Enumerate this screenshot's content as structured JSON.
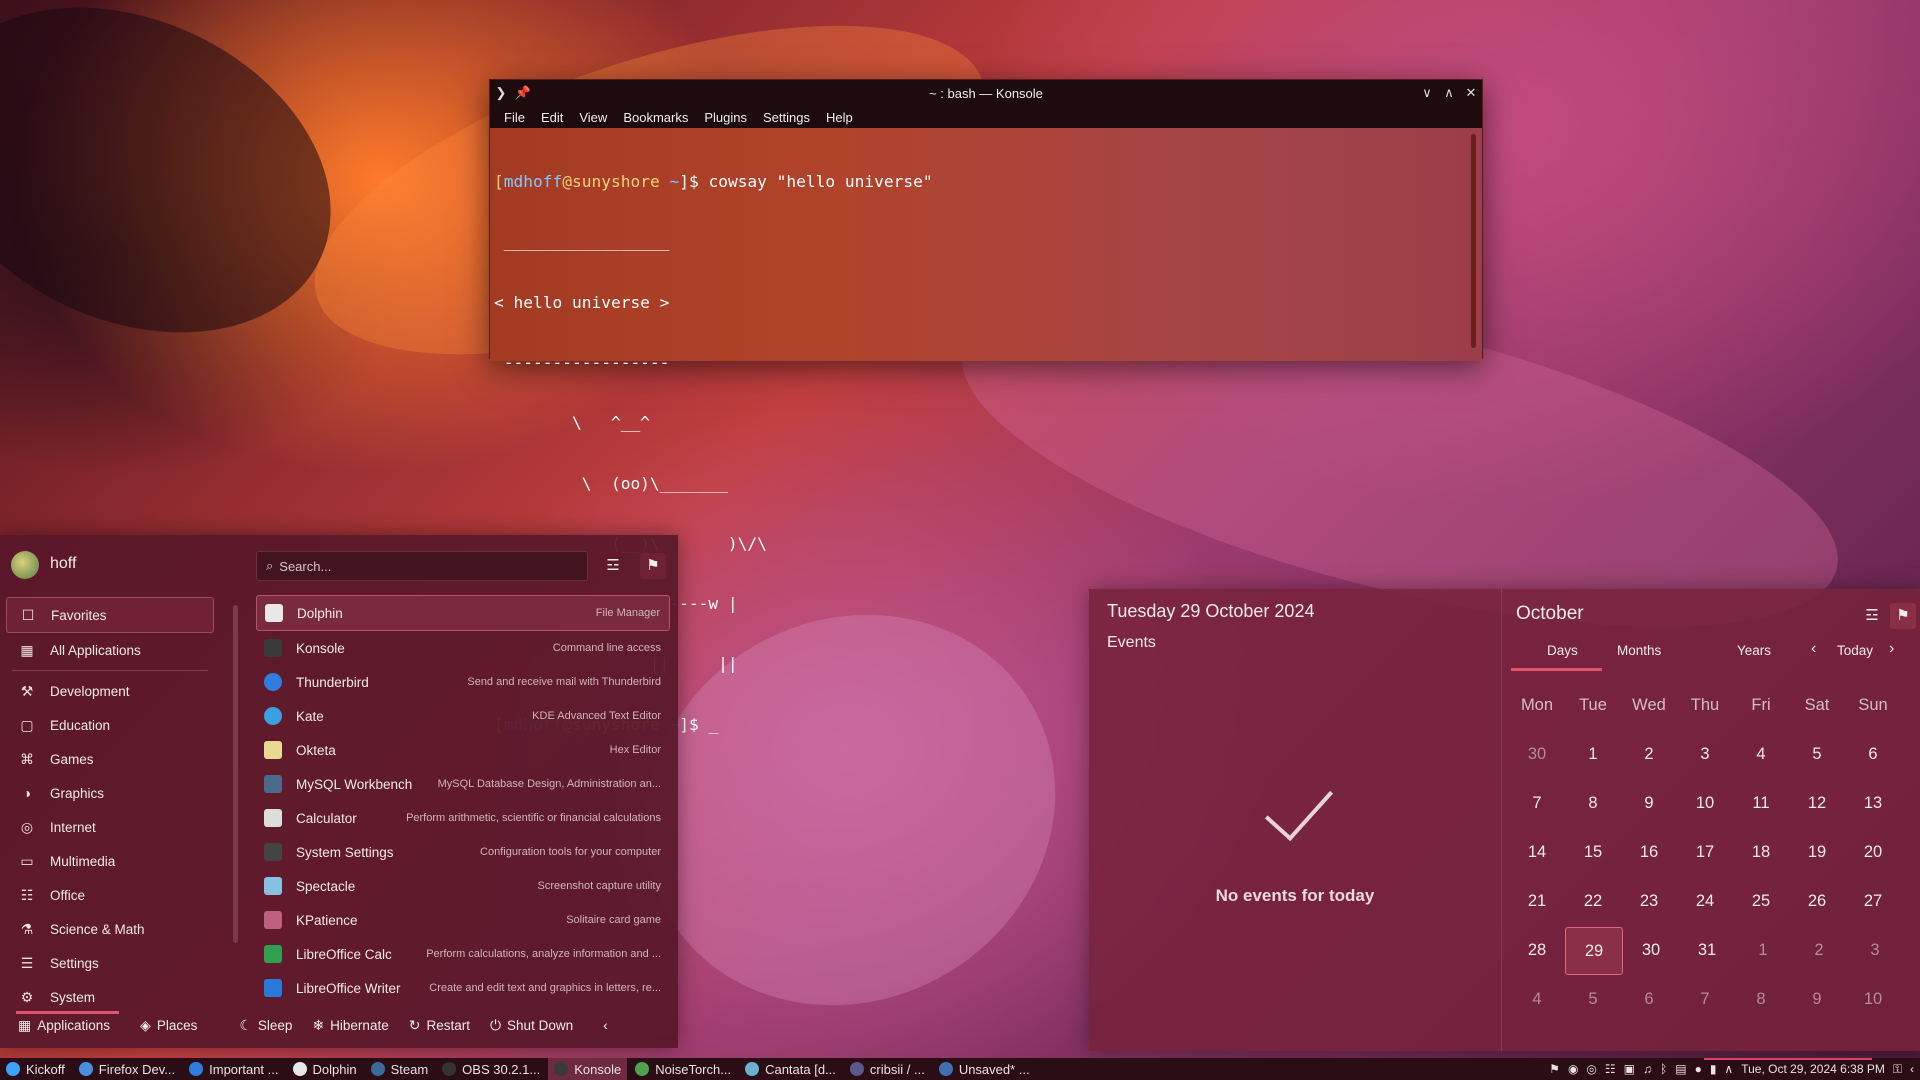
{
  "konsole": {
    "title": "~ : bash — Konsole",
    "menu": [
      "File",
      "Edit",
      "View",
      "Bookmarks",
      "Plugins",
      "Settings",
      "Help"
    ],
    "user": "mdhoff",
    "at": "@",
    "host": "sunyshore",
    "path": " ~",
    "prompt_end": "]$ ",
    "command": "cowsay \"hello universe\"",
    "output": [
      " _________________",
      "< hello universe >",
      " -----------------",
      "        \\   ^__^",
      "         \\  (oo)\\_______",
      "            (__)\\       )\\/\\",
      "                ||----w |",
      "                ||     ||"
    ],
    "cursor": "_"
  },
  "kickoff": {
    "username": "hoff",
    "search_placeholder": "Search...",
    "categories": [
      "Favorites",
      "All Applications",
      "Development",
      "Education",
      "Games",
      "Graphics",
      "Internet",
      "Multimedia",
      "Office",
      "Science & Math",
      "Settings",
      "System"
    ],
    "apps": [
      {
        "name": "Dolphin",
        "desc": "File Manager",
        "color": "#e8e8e8"
      },
      {
        "name": "Konsole",
        "desc": "Command line access",
        "color": "#3a3a3a"
      },
      {
        "name": "Thunderbird",
        "desc": "Send and receive mail with Thunderbird",
        "color": "#2f7de1"
      },
      {
        "name": "Kate",
        "desc": "KDE Advanced Text Editor",
        "color": "#3aa0e0"
      },
      {
        "name": "Okteta",
        "desc": "Hex Editor",
        "color": "#e8d890"
      },
      {
        "name": "MySQL Workbench",
        "desc": "MySQL Database Design, Administration an...",
        "color": "#4a6a8a"
      },
      {
        "name": "Calculator",
        "desc": "Perform arithmetic, scientific or financial calculations",
        "color": "#dddddd"
      },
      {
        "name": "System Settings",
        "desc": "Configuration tools for your computer",
        "color": "#444444"
      },
      {
        "name": "Spectacle",
        "desc": "Screenshot capture utility",
        "color": "#88c0e0"
      },
      {
        "name": "KPatience",
        "desc": "Solitaire card game",
        "color": "#c06080"
      },
      {
        "name": "LibreOffice Calc",
        "desc": "Perform calculations, analyze information and ...",
        "color": "#30a050"
      },
      {
        "name": "LibreOffice Writer",
        "desc": "Create and edit text and graphics in letters, re...",
        "color": "#2a7ad8"
      }
    ],
    "footer": {
      "applications": "Applications",
      "places": "Places",
      "sleep": "Sleep",
      "hibernate": "Hibernate",
      "restart": "Restart",
      "shutdown": "Shut Down"
    }
  },
  "calendar": {
    "date": "Tuesday 29 October 2024",
    "events_label": "Events",
    "no_events": "No events for today",
    "month": "October",
    "views": {
      "days": "Days",
      "months": "Months",
      "years": "Years",
      "today": "Today"
    },
    "weekdays": [
      "Mon",
      "Tue",
      "Wed",
      "Thu",
      "Fri",
      "Sat",
      "Sun"
    ],
    "weeks": [
      [
        [
          "30",
          1
        ],
        [
          "1",
          0
        ],
        [
          "2",
          0
        ],
        [
          "3",
          0
        ],
        [
          "4",
          0
        ],
        [
          "5",
          0
        ],
        [
          "6",
          0
        ]
      ],
      [
        [
          "7",
          0
        ],
        [
          "8",
          0
        ],
        [
          "9",
          0
        ],
        [
          "10",
          0
        ],
        [
          "11",
          0
        ],
        [
          "12",
          0
        ],
        [
          "13",
          0
        ]
      ],
      [
        [
          "14",
          0
        ],
        [
          "15",
          0
        ],
        [
          "16",
          0
        ],
        [
          "17",
          0
        ],
        [
          "18",
          0
        ],
        [
          "19",
          0
        ],
        [
          "20",
          0
        ]
      ],
      [
        [
          "21",
          0
        ],
        [
          "22",
          0
        ],
        [
          "23",
          0
        ],
        [
          "24",
          0
        ],
        [
          "25",
          0
        ],
        [
          "26",
          0
        ],
        [
          "27",
          0
        ]
      ],
      [
        [
          "28",
          0
        ],
        [
          "29",
          2
        ],
        [
          "30",
          0
        ],
        [
          "31",
          0
        ],
        [
          "1",
          1
        ],
        [
          "2",
          1
        ],
        [
          "3",
          1
        ]
      ],
      [
        [
          "4",
          1
        ],
        [
          "5",
          1
        ],
        [
          "6",
          1
        ],
        [
          "7",
          1
        ],
        [
          "8",
          1
        ],
        [
          "9",
          1
        ],
        [
          "10",
          1
        ]
      ]
    ]
  },
  "taskbar": {
    "items": [
      {
        "label": "Kickoff",
        "color": "#3ea0ff"
      },
      {
        "label": "Firefox Dev...",
        "color": "#4a8ee0"
      },
      {
        "label": "Important ...",
        "color": "#2f7de1"
      },
      {
        "label": "Dolphin",
        "color": "#e8e8e8"
      },
      {
        "label": "Steam",
        "color": "#3a6a9a"
      },
      {
        "label": "OBS 30.2.1...",
        "color": "#333333"
      },
      {
        "label": "Konsole",
        "color": "#3a3a3a"
      },
      {
        "label": "NoiseTorch...",
        "color": "#50a050"
      },
      {
        "label": "Cantata [d...",
        "color": "#6ab0d0"
      },
      {
        "label": "cribsii / ...",
        "color": "#5a5a8a"
      },
      {
        "label": "Unsaved* ...",
        "color": "#4070b0"
      }
    ],
    "clock": "Tue,  Oct 29, 2024 6:38 PM"
  }
}
